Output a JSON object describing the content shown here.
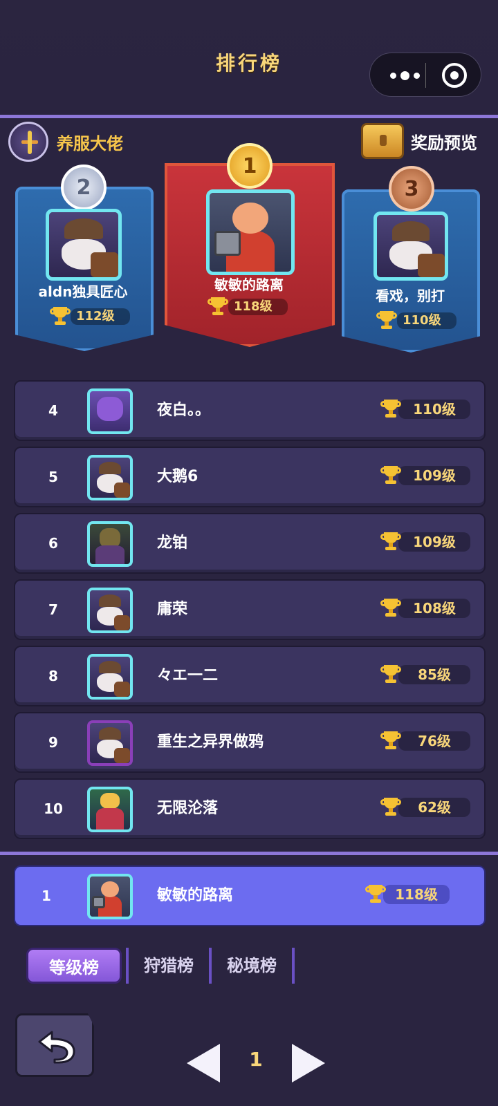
{
  "header": {
    "title": "排行榜"
  },
  "banner": {
    "left_label": "养服大佬",
    "reward_label": "奖励预览"
  },
  "podium": [
    {
      "rank": "1",
      "name": "敏敏的路离",
      "level": "118级"
    },
    {
      "rank": "2",
      "name": "aldn独具匠心",
      "level": "112级"
    },
    {
      "rank": "3",
      "name": "看戏，别打",
      "level": "110级"
    }
  ],
  "rankings": [
    {
      "rank": "4",
      "name": "夜白。。",
      "level": "110级",
      "avatar": "minotaur"
    },
    {
      "rank": "5",
      "name": "大鹅6",
      "level": "109级",
      "avatar": "viking"
    },
    {
      "rank": "6",
      "name": "龙铂",
      "level": "109级",
      "avatar": "goblin"
    },
    {
      "rank": "7",
      "name": "庸荣",
      "level": "108级",
      "avatar": "viking"
    },
    {
      "rank": "8",
      "name": "々エ一二",
      "level": "85级",
      "avatar": "viking"
    },
    {
      "rank": "9",
      "name": "重生之异界做鸦",
      "level": "76级",
      "avatar": "viking-frame"
    },
    {
      "rank": "10",
      "name": "无限沦落",
      "level": "62级",
      "avatar": "archer"
    }
  ],
  "my_rank": {
    "rank": "1",
    "name": "敏敏的路离",
    "level": "118级"
  },
  "tabs": [
    {
      "label": "等级榜",
      "active": true
    },
    {
      "label": "狩猎榜",
      "active": false
    },
    {
      "label": "秘境榜",
      "active": false
    }
  ],
  "pager": {
    "page": "1"
  },
  "colors": {
    "accent": "#8d77d8",
    "gold": "#f8d67a",
    "my_row": "#6c6cf0"
  }
}
